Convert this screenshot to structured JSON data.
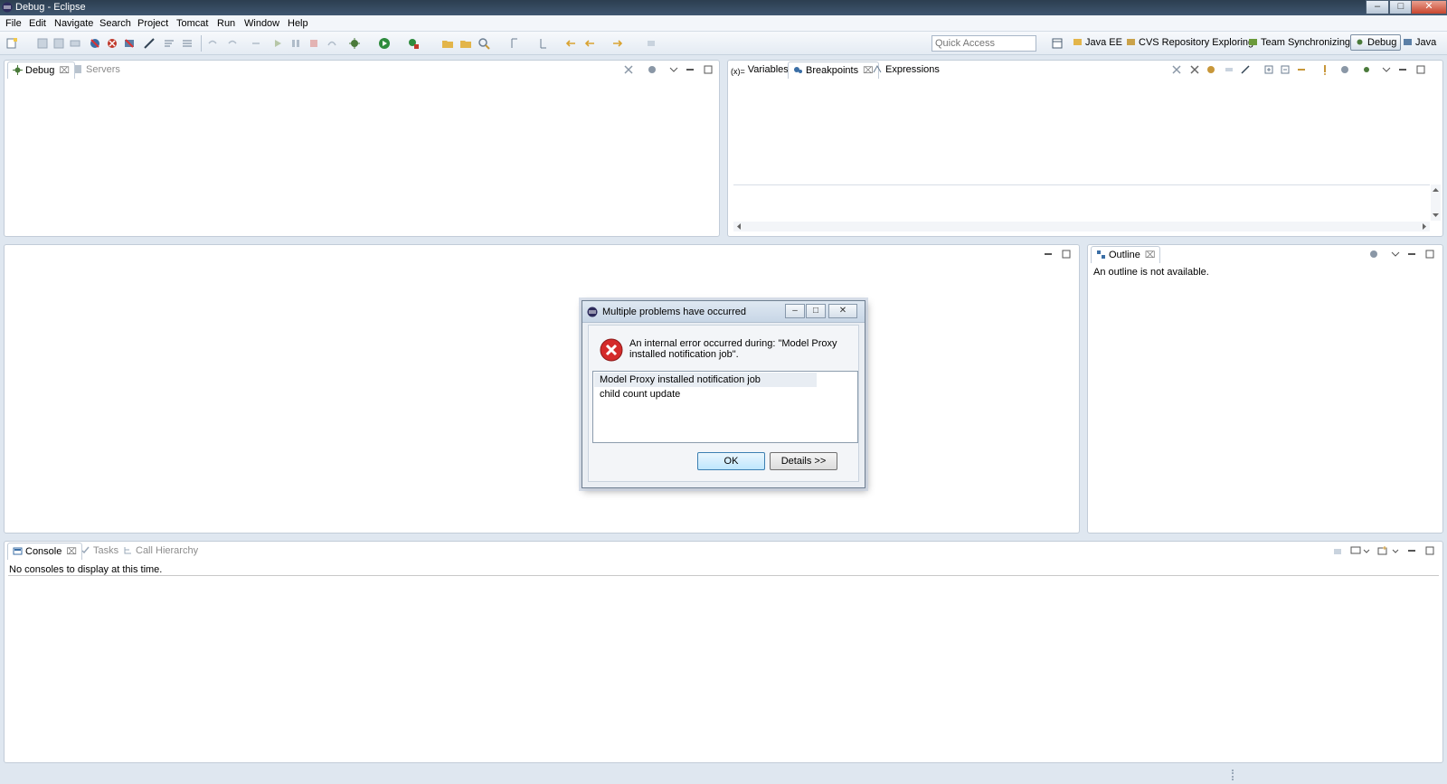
{
  "window": {
    "title": "Debug - Eclipse"
  },
  "menu": [
    "File",
    "Edit",
    "Navigate",
    "Search",
    "Project",
    "Tomcat",
    "Run",
    "Window",
    "Help"
  ],
  "toolbar": {
    "quick_access_placeholder": "Quick Access",
    "perspectives": [
      {
        "label": "Java EE",
        "icon": "java-ee-icon"
      },
      {
        "label": "CVS Repository Exploring",
        "icon": "cvs-icon"
      },
      {
        "label": "Team Synchronizing",
        "icon": "team-sync-icon"
      },
      {
        "label": "Debug",
        "icon": "debug-icon",
        "active": true
      },
      {
        "label": "Java",
        "icon": "java-icon"
      }
    ]
  },
  "debug_panel": {
    "tabs": [
      {
        "label": "Debug",
        "active": true
      },
      {
        "label": "Servers",
        "active": false
      }
    ]
  },
  "breakpoints_panel": {
    "tabs": [
      {
        "label": "Variables",
        "active": false
      },
      {
        "label": "Breakpoints",
        "active": true
      },
      {
        "label": "Expressions",
        "active": false
      }
    ]
  },
  "outline_panel": {
    "tab": "Outline",
    "message": "An outline is not available."
  },
  "console_panel": {
    "tabs": [
      {
        "label": "Console",
        "active": true
      },
      {
        "label": "Tasks",
        "active": false
      },
      {
        "label": "Call Hierarchy",
        "active": false
      }
    ],
    "message": "No consoles to display at this time."
  },
  "dialog": {
    "title": "Multiple problems have occurred",
    "message": "An internal error occurred during: \"Model Proxy installed notification job\".",
    "problems": [
      "Model Proxy installed notification job",
      "child count update"
    ],
    "ok_label": "OK",
    "details_label": "Details >>"
  },
  "colors": {
    "accent": "#3c7fb1",
    "error": "#d42a2a"
  }
}
